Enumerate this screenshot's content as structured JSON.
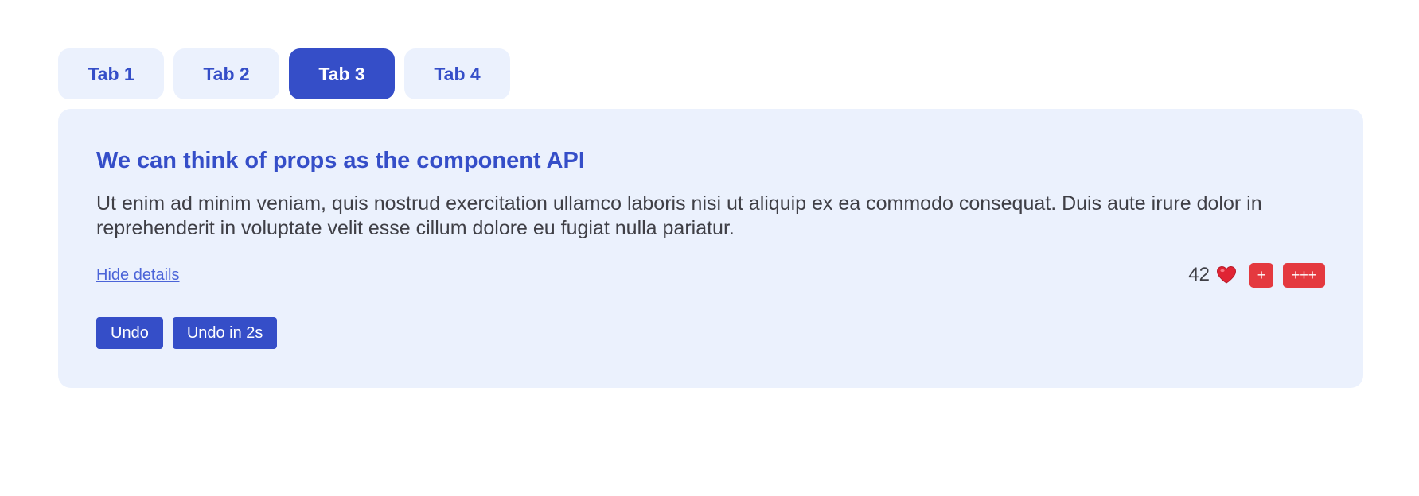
{
  "tabs": [
    {
      "label": "Tab 1",
      "active": false
    },
    {
      "label": "Tab 2",
      "active": false
    },
    {
      "label": "Tab 3",
      "active": true
    },
    {
      "label": "Tab 4",
      "active": false
    }
  ],
  "panel": {
    "title": "We can think of props as the component API",
    "body": "Ut enim ad minim veniam, quis nostrud exercitation ullamco laboris nisi ut aliquip ex ea commodo consequat. Duis aute irure dolor in reprehenderit in voluptate velit esse cillum dolore eu fugiat nulla pariatur.",
    "hide_details_label": "Hide details",
    "likes": {
      "count": "42",
      "icon": "heart-icon",
      "plus_label": "+",
      "plus3_label": "+++"
    },
    "undo_label": "Undo",
    "undo_delay_label": "Undo in 2s"
  },
  "colors": {
    "accent": "#354ec8",
    "tab_inactive_bg": "#ebf1fd",
    "panel_bg": "#ebf1fd",
    "danger": "#e4393f",
    "text": "#3f3f46",
    "link": "#4b64d8"
  }
}
